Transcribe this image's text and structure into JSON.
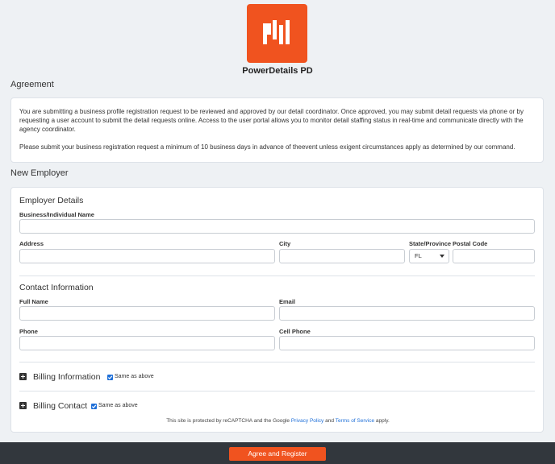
{
  "brand": {
    "name": "PowerDetails PD",
    "logo_icon": "powerdetails-pd-logo",
    "accent_color": "#f0531f"
  },
  "agreement": {
    "title": "Agreement",
    "paragraph1": "You are submitting a business profile registration request to be reviewed and approved by our detail coordinator. Once approved, you may submit detail requests via phone or by requesting a user account to submit the detail requests online. Access to the user portal allows you to monitor detail staffing status in real-time and communicate directly with the agency coordinator.",
    "paragraph2": "Please submit your business registration request a minimum of 10 business days in advance of theevent unless exigent circumstances apply as determined by our command."
  },
  "new_employer": {
    "title": "New Employer",
    "employer_details": {
      "heading": "Employer Details",
      "business_name_label": "Business/Individual Name",
      "address_label": "Address",
      "city_label": "City",
      "state_label": "State/Province",
      "state_value": "FL",
      "postal_label": "Postal Code"
    },
    "contact_information": {
      "heading": "Contact Information",
      "full_name_label": "Full Name",
      "email_label": "Email",
      "phone_label": "Phone",
      "cell_phone_label": "Cell Phone"
    },
    "billing_information": {
      "label": "Billing Information",
      "same_as_above": "Same as above",
      "checked": true
    },
    "billing_contact": {
      "label": "Billing Contact",
      "same_as_above": "Same as above",
      "checked": true
    },
    "recaptcha": {
      "prefix": "This site is protected by reCAPTCHA and the Google",
      "privacy_link": "Privacy Policy",
      "and": "and",
      "terms_link": "Terms of Service",
      "suffix": "apply."
    }
  },
  "footer": {
    "submit_label": "Agree and Register"
  }
}
